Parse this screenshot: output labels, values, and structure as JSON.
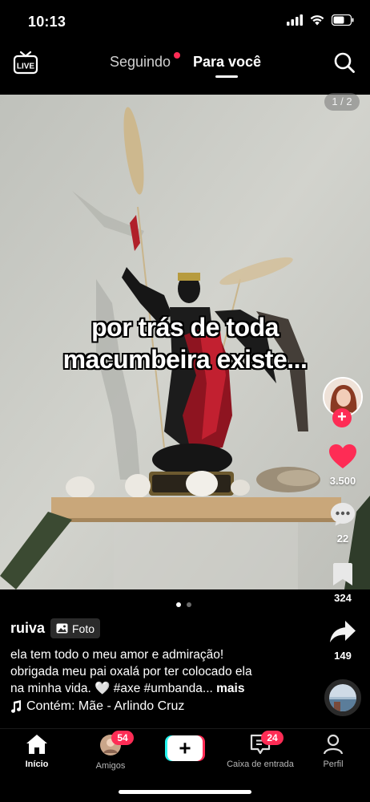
{
  "status_bar": {
    "time": "10:13"
  },
  "top_nav": {
    "live_label": "LIVE",
    "tabs": [
      {
        "label": "Seguindo",
        "active": false,
        "has_dot": true
      },
      {
        "label": "Para você",
        "active": true
      }
    ]
  },
  "post": {
    "page_counter": "1 / 2",
    "overlay_text_line1": "por trás de toda",
    "overlay_text_line2": "macumbeira existe...",
    "likes": "3.500",
    "comments": "22",
    "saves": "324",
    "shares": "149",
    "username": "ruiva",
    "badge_label": "Foto",
    "caption_line1": "ela tem todo o meu amor e admiração!",
    "caption_line2": "obrigada meu pai oxalá por ter colocado ela",
    "caption_line3": "na minha vida. 🤍 #axe #umbanda...",
    "caption_more": "mais",
    "music": "Contém: Mãe - Arlindo Cruz",
    "photo_slides": 2,
    "current_slide": 1
  },
  "bottom_nav": {
    "home": "Início",
    "friends": "Amigos",
    "friends_badge": "54",
    "create": "+",
    "inbox": "Caixa de entrada",
    "inbox_badge": "24",
    "profile": "Perfil"
  },
  "colors": {
    "accent": "#fe2c55",
    "background": "#000000",
    "create_cyan": "#25f4ee"
  },
  "icons": [
    "live-icon",
    "search-icon",
    "heart-icon",
    "comment-icon",
    "bookmark-icon",
    "share-icon",
    "photo-icon",
    "music-note-icon",
    "home-icon",
    "inbox-icon",
    "profile-icon"
  ]
}
